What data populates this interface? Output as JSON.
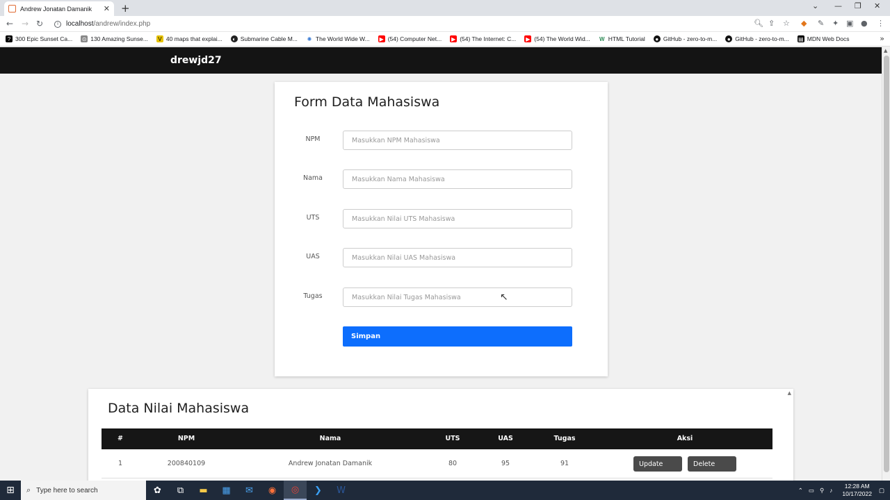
{
  "browser": {
    "tab_title": "Andrew Jonatan Damanik",
    "tab_close": "✕",
    "new_tab": "+",
    "url_host": "localhost",
    "url_path": "/andrew/index.php",
    "bookmarks": [
      {
        "label": "300 Epic Sunset Ca...",
        "icon": "question-icon",
        "color": "#000000"
      },
      {
        "label": "130 Amazing Sunse...",
        "icon": "pin-icon",
        "color": "#888888"
      },
      {
        "label": "40 maps that explai...",
        "icon": "v-logo-icon",
        "color": "#e6c200"
      },
      {
        "label": "Submarine Cable M...",
        "icon": "globe-icon",
        "color": "#222222"
      },
      {
        "label": "The World Wide W...",
        "icon": "web-icon",
        "color": "#3a7bd5"
      },
      {
        "label": "(54) Computer Net...",
        "icon": "youtube-icon",
        "color": "#ff0000"
      },
      {
        "label": "(54) The Internet: C...",
        "icon": "youtube-icon",
        "color": "#ff0000"
      },
      {
        "label": "(54) The World Wid...",
        "icon": "youtube-icon",
        "color": "#ff0000"
      },
      {
        "label": "HTML Tutorial",
        "icon": "w3-icon",
        "color": "#2e8b57"
      },
      {
        "label": "GitHub - zero-to-m...",
        "icon": "github-icon",
        "color": "#111111"
      },
      {
        "label": "GitHub - zero-to-m...",
        "icon": "github-icon",
        "color": "#111111"
      },
      {
        "label": "MDN Web Docs",
        "icon": "mdn-icon",
        "color": "#000000"
      }
    ]
  },
  "navbar": {
    "brand": "drewjd27"
  },
  "form": {
    "title": "Form Data Mahasiswa",
    "fields": [
      {
        "label": "NPM",
        "placeholder": "Masukkan NPM Mahasiswa"
      },
      {
        "label": "Nama",
        "placeholder": "Masukkan Nama Mahasiswa"
      },
      {
        "label": "UTS",
        "placeholder": "Masukkan Nilai UTS Mahasiswa"
      },
      {
        "label": "UAS",
        "placeholder": "Masukkan Nilai UAS Mahasiswa"
      },
      {
        "label": "Tugas",
        "placeholder": "Masukkan Nilai Tugas Mahasiswa"
      }
    ],
    "submit_label": "Simpan",
    "accent_color": "#0d6efd"
  },
  "table": {
    "title": "Data Nilai Mahasiswa",
    "headers": [
      "#",
      "NPM",
      "Nama",
      "UTS",
      "UAS",
      "Tugas",
      "Aksi"
    ],
    "rows": [
      {
        "no": "1",
        "npm": "200840109",
        "nama": "Andrew Jonatan Damanik",
        "uts": "80",
        "uas": "95",
        "tugas": "91",
        "update_label": "Update",
        "delete_label": "Delete"
      }
    ]
  },
  "taskbar": {
    "search_placeholder": "Type here to search",
    "time": "12:28 AM",
    "date": "10/17/2022"
  }
}
